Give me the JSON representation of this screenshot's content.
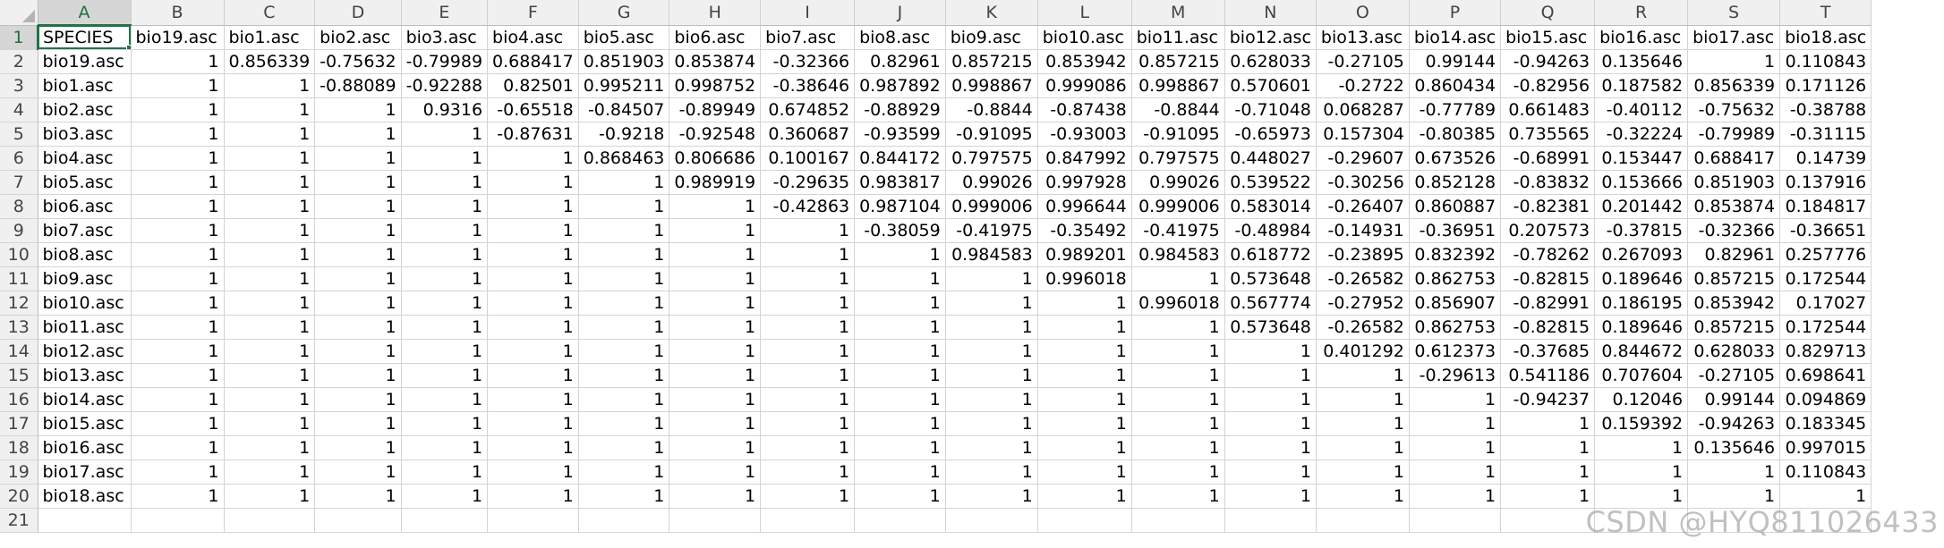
{
  "sheet": {
    "columns": [
      "A",
      "B",
      "C",
      "D",
      "E",
      "F",
      "G",
      "H",
      "I",
      "J",
      "K",
      "L",
      "M",
      "N",
      "O",
      "P",
      "Q",
      "R",
      "S",
      "T"
    ],
    "selected_cell": "A1",
    "rows": [
      [
        "SPECIES",
        "bio19.asc",
        "bio1.asc",
        "bio2.asc",
        "bio3.asc",
        "bio4.asc",
        "bio5.asc",
        "bio6.asc",
        "bio7.asc",
        "bio8.asc",
        "bio9.asc",
        "bio10.asc",
        "bio11.asc",
        "bio12.asc",
        "bio13.asc",
        "bio14.asc",
        "bio15.asc",
        "bio16.asc",
        "bio17.asc",
        "bio18.asc"
      ],
      [
        "bio19.asc",
        "1",
        "0.856339",
        "-0.75632",
        "-0.79989",
        "0.688417",
        "0.851903",
        "0.853874",
        "-0.32366",
        "0.82961",
        "0.857215",
        "0.853942",
        "0.857215",
        "0.628033",
        "-0.27105",
        "0.99144",
        "-0.94263",
        "0.135646",
        "1",
        "0.110843"
      ],
      [
        "bio1.asc",
        "1",
        "1",
        "-0.88089",
        "-0.92288",
        "0.82501",
        "0.995211",
        "0.998752",
        "-0.38646",
        "0.987892",
        "0.998867",
        "0.999086",
        "0.998867",
        "0.570601",
        "-0.2722",
        "0.860434",
        "-0.82956",
        "0.187582",
        "0.856339",
        "0.171126"
      ],
      [
        "bio2.asc",
        "1",
        "1",
        "1",
        "0.9316",
        "-0.65518",
        "-0.84507",
        "-0.89949",
        "0.674852",
        "-0.88929",
        "-0.8844",
        "-0.87438",
        "-0.8844",
        "-0.71048",
        "0.068287",
        "-0.77789",
        "0.661483",
        "-0.40112",
        "-0.75632",
        "-0.38788"
      ],
      [
        "bio3.asc",
        "1",
        "1",
        "1",
        "1",
        "-0.87631",
        "-0.9218",
        "-0.92548",
        "0.360687",
        "-0.93599",
        "-0.91095",
        "-0.93003",
        "-0.91095",
        "-0.65973",
        "0.157304",
        "-0.80385",
        "0.735565",
        "-0.32224",
        "-0.79989",
        "-0.31115"
      ],
      [
        "bio4.asc",
        "1",
        "1",
        "1",
        "1",
        "1",
        "0.868463",
        "0.806686",
        "0.100167",
        "0.844172",
        "0.797575",
        "0.847992",
        "0.797575",
        "0.448027",
        "-0.29607",
        "0.673526",
        "-0.68991",
        "0.153447",
        "0.688417",
        "0.14739"
      ],
      [
        "bio5.asc",
        "1",
        "1",
        "1",
        "1",
        "1",
        "1",
        "0.989919",
        "-0.29635",
        "0.983817",
        "0.99026",
        "0.997928",
        "0.99026",
        "0.539522",
        "-0.30256",
        "0.852128",
        "-0.83832",
        "0.153666",
        "0.851903",
        "0.137916"
      ],
      [
        "bio6.asc",
        "1",
        "1",
        "1",
        "1",
        "1",
        "1",
        "1",
        "-0.42863",
        "0.987104",
        "0.999006",
        "0.996644",
        "0.999006",
        "0.583014",
        "-0.26407",
        "0.860887",
        "-0.82381",
        "0.201442",
        "0.853874",
        "0.184817"
      ],
      [
        "bio7.asc",
        "1",
        "1",
        "1",
        "1",
        "1",
        "1",
        "1",
        "1",
        "-0.38059",
        "-0.41975",
        "-0.35492",
        "-0.41975",
        "-0.48984",
        "-0.14931",
        "-0.36951",
        "0.207573",
        "-0.37815",
        "-0.32366",
        "-0.36651"
      ],
      [
        "bio8.asc",
        "1",
        "1",
        "1",
        "1",
        "1",
        "1",
        "1",
        "1",
        "1",
        "0.984583",
        "0.989201",
        "0.984583",
        "0.618772",
        "-0.23895",
        "0.832392",
        "-0.78262",
        "0.267093",
        "0.82961",
        "0.257776"
      ],
      [
        "bio9.asc",
        "1",
        "1",
        "1",
        "1",
        "1",
        "1",
        "1",
        "1",
        "1",
        "1",
        "0.996018",
        "1",
        "0.573648",
        "-0.26582",
        "0.862753",
        "-0.82815",
        "0.189646",
        "0.857215",
        "0.172544"
      ],
      [
        "bio10.asc",
        "1",
        "1",
        "1",
        "1",
        "1",
        "1",
        "1",
        "1",
        "1",
        "1",
        "1",
        "0.996018",
        "0.567774",
        "-0.27952",
        "0.856907",
        "-0.82991",
        "0.186195",
        "0.853942",
        "0.17027"
      ],
      [
        "bio11.asc",
        "1",
        "1",
        "1",
        "1",
        "1",
        "1",
        "1",
        "1",
        "1",
        "1",
        "1",
        "1",
        "0.573648",
        "-0.26582",
        "0.862753",
        "-0.82815",
        "0.189646",
        "0.857215",
        "0.172544"
      ],
      [
        "bio12.asc",
        "1",
        "1",
        "1",
        "1",
        "1",
        "1",
        "1",
        "1",
        "1",
        "1",
        "1",
        "1",
        "1",
        "0.401292",
        "0.612373",
        "-0.37685",
        "0.844672",
        "0.628033",
        "0.829713"
      ],
      [
        "bio13.asc",
        "1",
        "1",
        "1",
        "1",
        "1",
        "1",
        "1",
        "1",
        "1",
        "1",
        "1",
        "1",
        "1",
        "1",
        "-0.29613",
        "0.541186",
        "0.707604",
        "-0.27105",
        "0.698641"
      ],
      [
        "bio14.asc",
        "1",
        "1",
        "1",
        "1",
        "1",
        "1",
        "1",
        "1",
        "1",
        "1",
        "1",
        "1",
        "1",
        "1",
        "1",
        "-0.94237",
        "0.12046",
        "0.99144",
        "0.094869"
      ],
      [
        "bio15.asc",
        "1",
        "1",
        "1",
        "1",
        "1",
        "1",
        "1",
        "1",
        "1",
        "1",
        "1",
        "1",
        "1",
        "1",
        "1",
        "1",
        "0.159392",
        "-0.94263",
        "0.183345"
      ],
      [
        "bio16.asc",
        "1",
        "1",
        "1",
        "1",
        "1",
        "1",
        "1",
        "1",
        "1",
        "1",
        "1",
        "1",
        "1",
        "1",
        "1",
        "1",
        "1",
        "0.135646",
        "0.997015"
      ],
      [
        "bio17.asc",
        "1",
        "1",
        "1",
        "1",
        "1",
        "1",
        "1",
        "1",
        "1",
        "1",
        "1",
        "1",
        "1",
        "1",
        "1",
        "1",
        "1",
        "1",
        "0.110843"
      ],
      [
        "bio18.asc",
        "1",
        "1",
        "1",
        "1",
        "1",
        "1",
        "1",
        "1",
        "1",
        "1",
        "1",
        "1",
        "1",
        "1",
        "1",
        "1",
        "1",
        "1",
        "1"
      ]
    ],
    "row_count": 21
  },
  "watermark": "CSDN @HYQ811026433"
}
